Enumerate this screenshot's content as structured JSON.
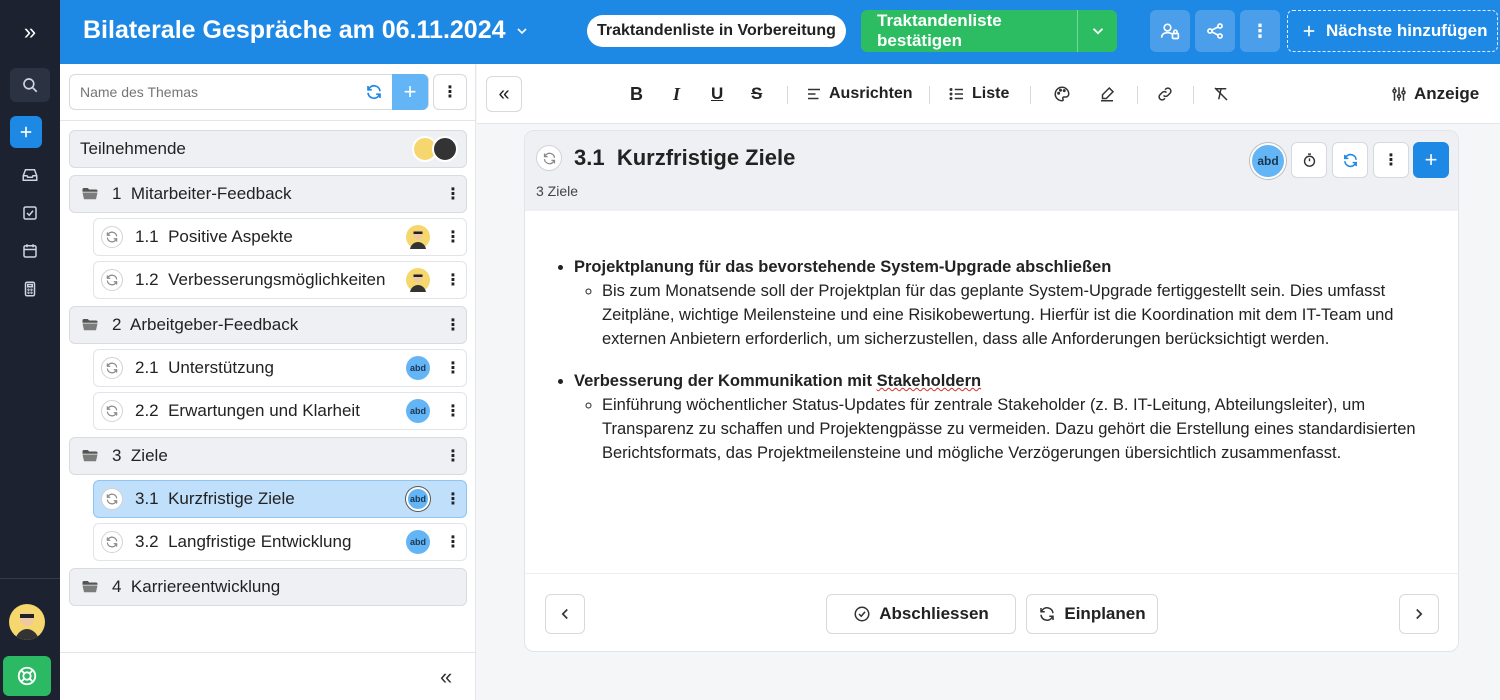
{
  "header": {
    "title": "Bilaterale Gespräche am 06.11.2024",
    "status": "Traktandenliste in Vorbereitung",
    "confirm_label": "Traktandenliste bestätigen",
    "next_label": "Nächste hinzufügen"
  },
  "sidebar": {
    "search_placeholder": "Name des Themas",
    "participants_label": "Teilnehmende",
    "sections": [
      {
        "number": "1",
        "label": "Mitarbeiter-Feedback",
        "items": [
          {
            "number": "1.1",
            "label": "Positive Aspekte",
            "avatar": "yellow"
          },
          {
            "number": "1.2",
            "label": "Verbesserungsmöglichkeiten",
            "avatar": "yellow"
          }
        ]
      },
      {
        "number": "2",
        "label": "Arbeitgeber-Feedback",
        "items": [
          {
            "number": "2.1",
            "label": "Unterstützung",
            "avatar": "abd"
          },
          {
            "number": "2.2",
            "label": "Erwartungen und Klarheit",
            "avatar": "abd"
          }
        ]
      },
      {
        "number": "3",
        "label": "Ziele",
        "items": [
          {
            "number": "3.1",
            "label": "Kurzfristige Ziele",
            "avatar": "abd",
            "active": true
          },
          {
            "number": "3.2",
            "label": "Langfristige Entwicklung",
            "avatar": "abd"
          }
        ]
      },
      {
        "number": "4",
        "label": "Karriereentwicklung",
        "items": []
      }
    ]
  },
  "toolbar": {
    "align_label": "Ausrichten",
    "list_label": "Liste",
    "view_label": "Anzeige"
  },
  "topic": {
    "number": "3.1",
    "title": "Kurzfristige Ziele",
    "subtitle": "3 Ziele",
    "avatar_initials": "abd",
    "bullets": [
      {
        "heading": "Projektplanung für das bevorstehende System-Upgrade abschließen",
        "text": "Bis zum Monatsende soll der Projektplan für das geplante System-Upgrade fertiggestellt sein. Dies umfasst Zeitpläne, wichtige Meilensteine und eine Risikobewertung. Hierfür ist die Koordination mit dem IT-Team und externen Anbietern erforderlich, um sicherzustellen, dass alle Anforderungen berücksichtigt werden."
      },
      {
        "heading_pre": "Verbesserung der Kommunikation mit ",
        "heading_err": "Stakeholdern",
        "text": "Einführung wöchentlicher Status-Updates für zentrale Stakeholder (z. B. IT-Leitung, Abteilungsleiter), um Transparenz zu schaffen und Projektengpässe zu vermeiden. Dazu gehört die Erstellung eines standardisierten Berichtsformats, das Projektmeilensteine und mögliche Verzögerungen übersichtlich zusammenfasst."
      }
    ],
    "complete_label": "Abschliessen",
    "schedule_label": "Einplanen"
  },
  "colors": {
    "brand_blue": "#1e88e5",
    "confirm_green": "#2cbd63",
    "rail_dark": "#1c2230",
    "active_row": "#bfdffb"
  },
  "icons": [
    "double-chevron-right-icon",
    "search-icon",
    "plus-icon",
    "inbox-icon",
    "checkbox-icon",
    "calendar-icon",
    "calculator-icon",
    "lifebuoy-icon",
    "chevron-down-icon",
    "user-lock-icon",
    "share-icon",
    "more-vertical-icon",
    "refresh-icon",
    "folder-icon",
    "bold-icon",
    "italic-icon",
    "underline-icon",
    "strikethrough-icon",
    "align-icon",
    "list-icon",
    "palette-icon",
    "highlighter-icon",
    "link-icon",
    "clear-format-icon",
    "sliders-icon",
    "timer-icon",
    "check-circle-icon",
    "chevron-left-icon",
    "chevron-right-icon"
  ]
}
